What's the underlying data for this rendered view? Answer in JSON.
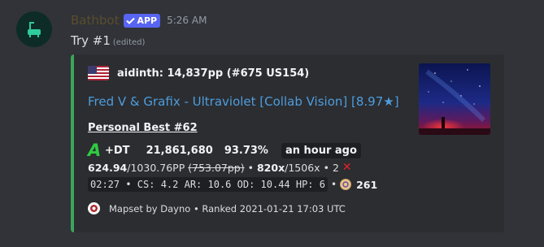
{
  "message": {
    "username": "Bathbot",
    "app_badge": "APP",
    "timestamp": "5:26 AM",
    "content": "Try #1",
    "edited_label": "(edited)"
  },
  "embed": {
    "accent_color": "#3ba55c",
    "author": {
      "name": "aidinth: 14,837pp (#675 US154)",
      "flag_icon": "us-flag-icon"
    },
    "title": "Fred V & Grafix - Ultraviolet [Collab Vision] [8.97★]",
    "field_name": "Personal Best #62",
    "line1": {
      "grade": "A",
      "mods": "+DT",
      "score": "21,861,680",
      "accuracy": "93.73%",
      "time_ago": "an hour ago"
    },
    "line2": {
      "pp": "624.94",
      "pp_max": "/1030.76PP",
      "pp_fc": "(753.07pp)",
      "separator1": "•",
      "combo": "820x",
      "max_combo": "/1506x",
      "separator2": "•",
      "misses": "2",
      "miss_icon": "✕"
    },
    "line3": {
      "stats": "02:27 • CS: 4.2 AR: 10.6 OD: 10.44 HP: 6",
      "separator": "•",
      "combo_icon": "osu-circle-icon",
      "circles": "261"
    },
    "footer": {
      "text": "Mapset by Dayno • Ranked 2021-01-21 17:03 UTC",
      "icon": "osu-logo-icon"
    }
  }
}
